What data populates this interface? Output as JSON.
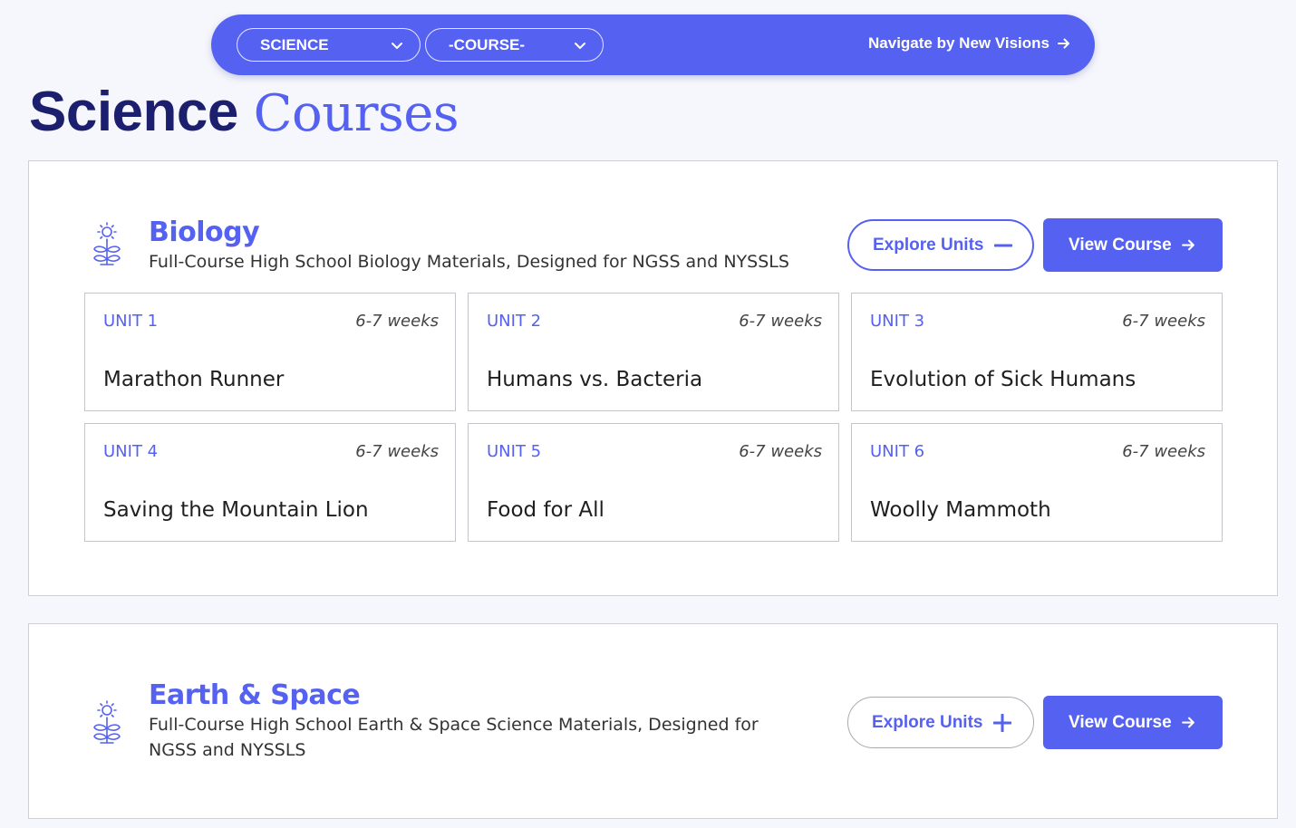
{
  "nav": {
    "subject_value": "SCIENCE",
    "course_value": "-COURSE-",
    "navigate_label": "Navigate by New Visions",
    "accent_color": "#5561f1"
  },
  "page": {
    "title_part1": "Science",
    "title_part2": "Courses"
  },
  "courses": [
    {
      "name": "Biology",
      "description": "Full-Course High School Biology Materials, Designed for NGSS and NYSSLS",
      "explore_label": "Explore Units",
      "explore_state": "expanded",
      "view_label": "View Course",
      "icon": "plant-sun-icon",
      "units": [
        {
          "label": "UNIT 1",
          "duration": "6-7 weeks",
          "title": "Marathon Runner"
        },
        {
          "label": "UNIT 2",
          "duration": "6-7 weeks",
          "title": "Humans vs. Bacteria"
        },
        {
          "label": "UNIT 3",
          "duration": "6-7 weeks",
          "title": "Evolution of Sick Humans"
        },
        {
          "label": "UNIT 4",
          "duration": "6-7 weeks",
          "title": "Saving the Mountain Lion"
        },
        {
          "label": "UNIT 5",
          "duration": "6-7 weeks",
          "title": "Food for All"
        },
        {
          "label": "UNIT 6",
          "duration": "6-7 weeks",
          "title": "Woolly Mammoth"
        }
      ]
    },
    {
      "name": "Earth & Space",
      "description": "Full-Course High School Earth & Space Science Materials, Designed for NGSS and NYSSLS",
      "explore_label": "Explore Units",
      "explore_state": "collapsed",
      "view_label": "View Course",
      "icon": "plant-sun-icon"
    }
  ]
}
